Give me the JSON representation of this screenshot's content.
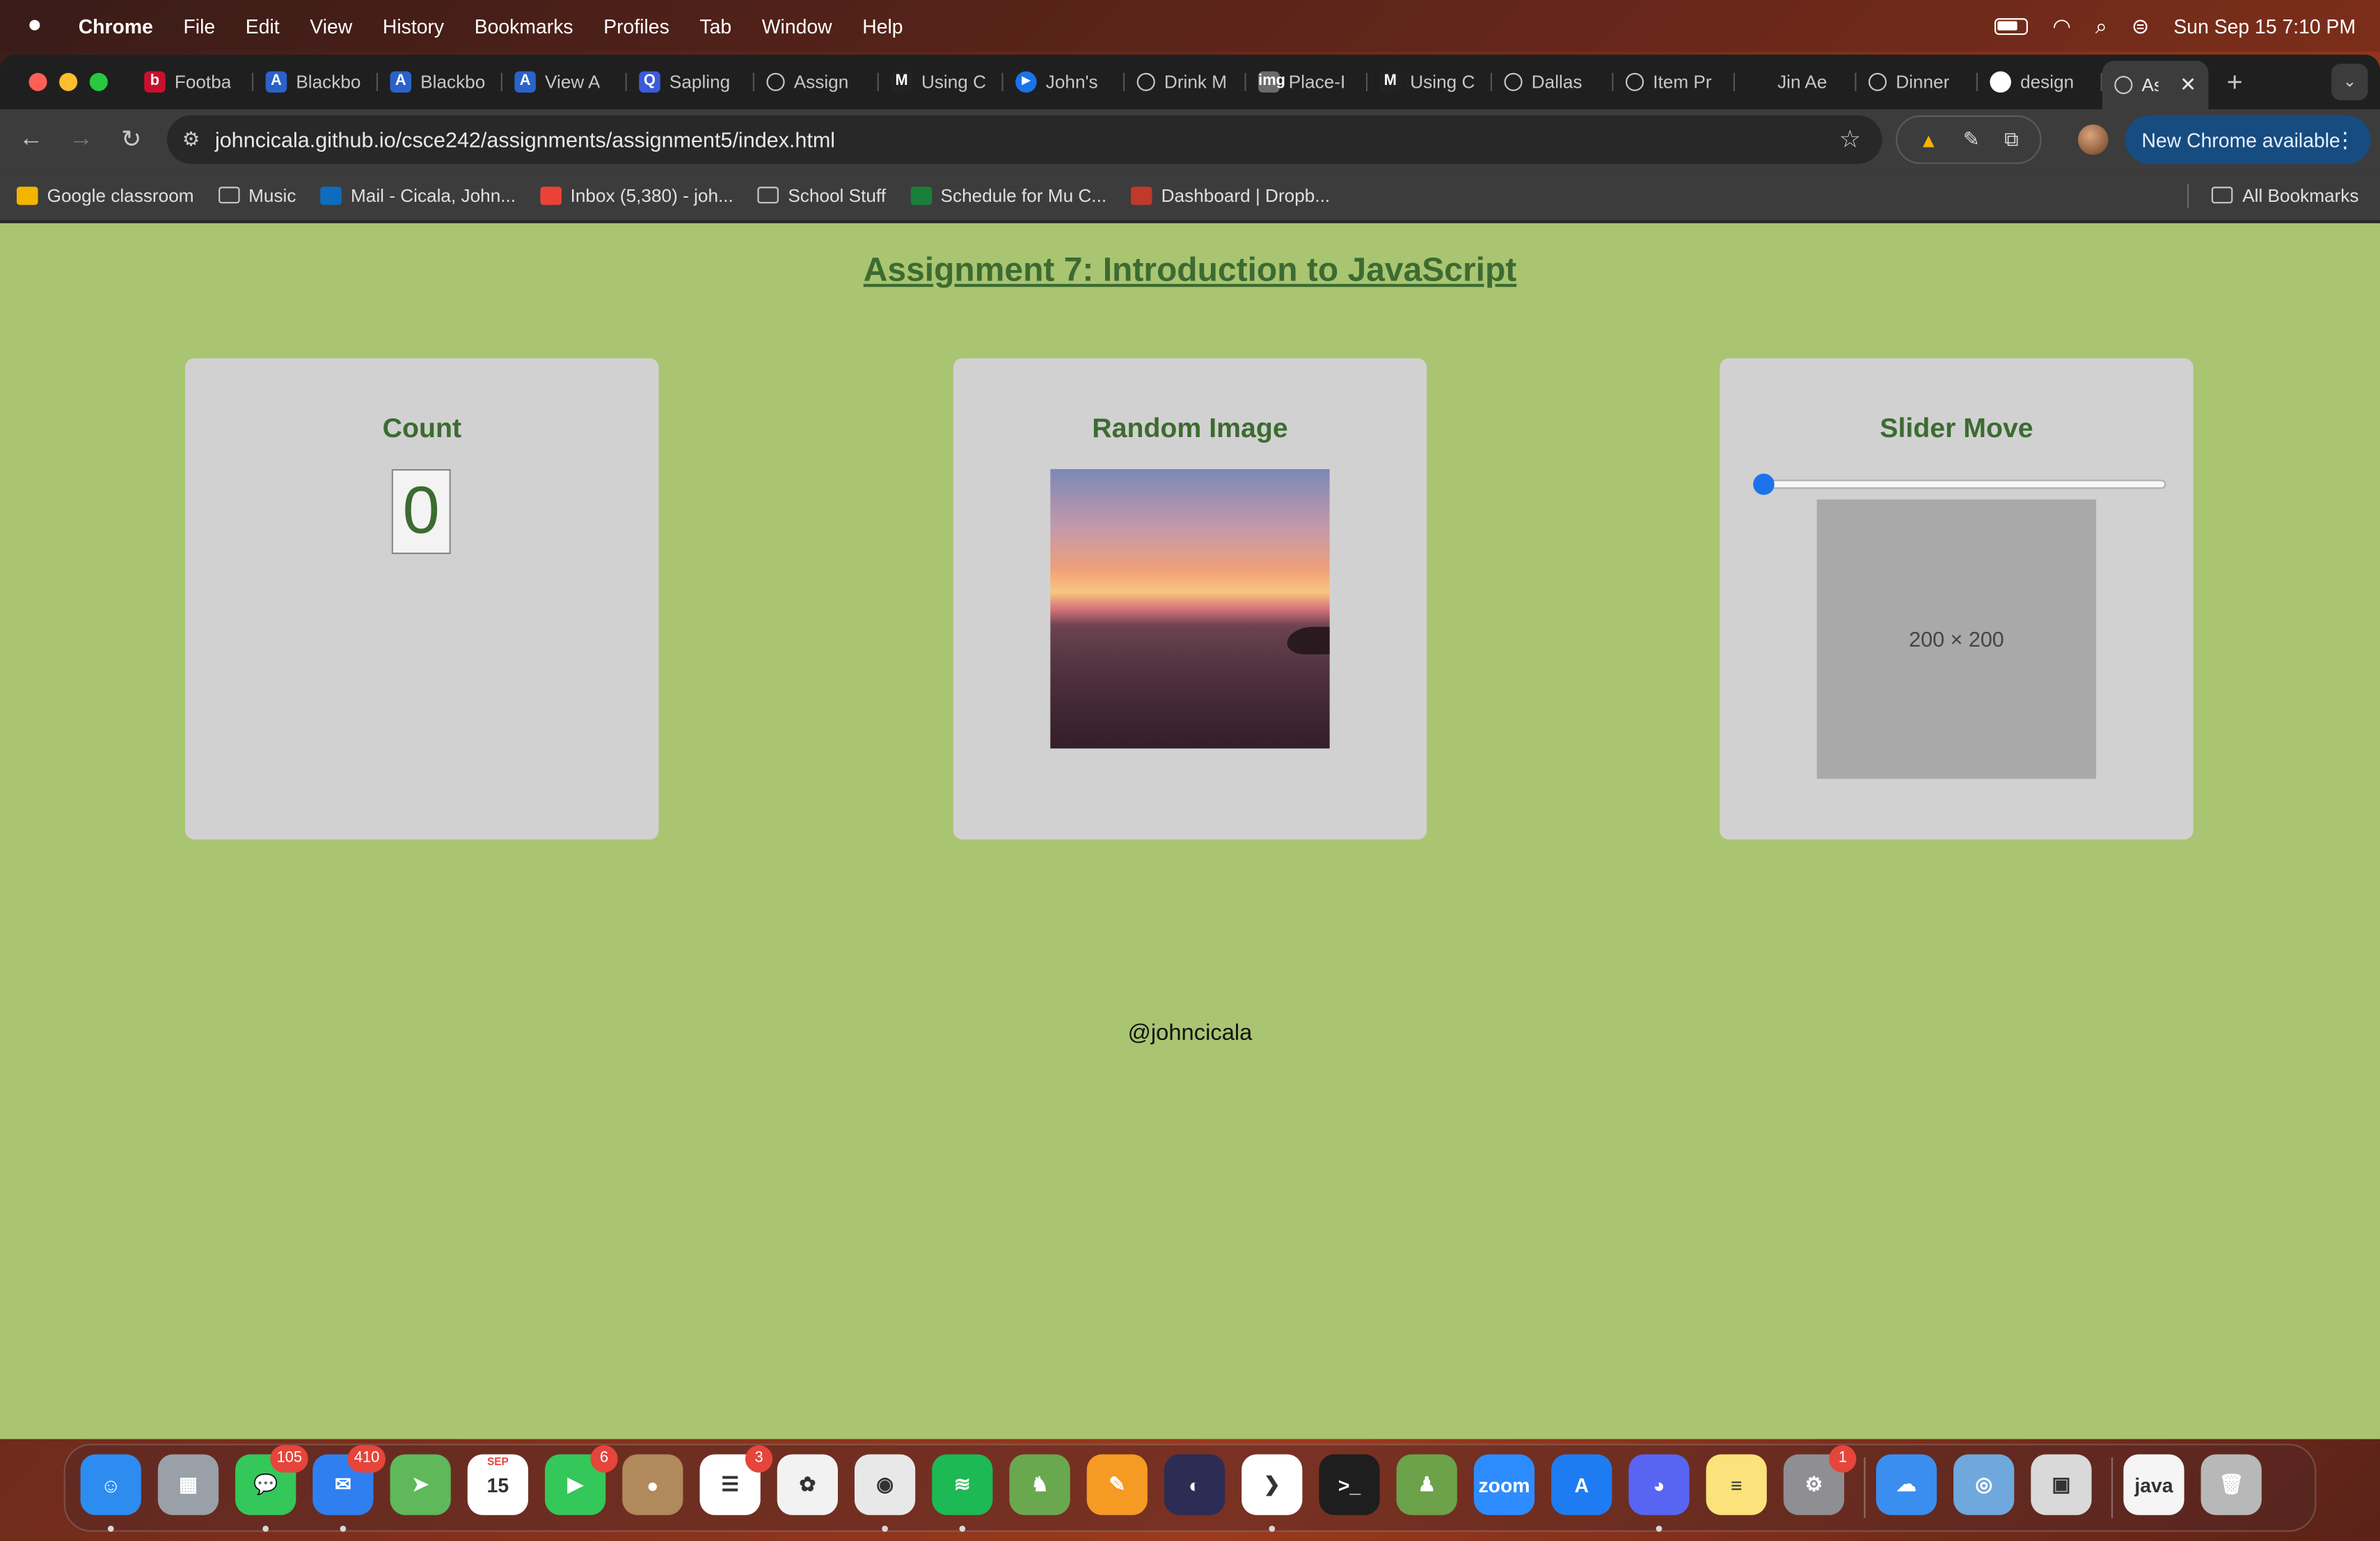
{
  "menubar": {
    "app_name": "Chrome",
    "menus": [
      "File",
      "Edit",
      "View",
      "History",
      "Bookmarks",
      "Profiles",
      "Tab",
      "Window",
      "Help"
    ],
    "datetime": "Sun Sep 15  7:10 PM"
  },
  "tabs": [
    {
      "label": "Footba",
      "icon": "b",
      "color": "#c8102e"
    },
    {
      "label": "Blackbo",
      "icon": "A",
      "color": "#2a62c9"
    },
    {
      "label": "Blackbo",
      "icon": "A",
      "color": "#2a62c9"
    },
    {
      "label": "View A",
      "icon": "A",
      "color": "#2a62c9"
    },
    {
      "label": "Sapling",
      "icon": "Q",
      "color": "#3b5bdb"
    },
    {
      "label": "Assign",
      "icon": "globe",
      "color": "#5f6368"
    },
    {
      "label": "Using C",
      "icon": "M",
      "color": "#222222"
    },
    {
      "label": "John's",
      "icon": "play",
      "color": "#1a73e8"
    },
    {
      "label": "Drink M",
      "icon": "globe",
      "color": "#5f6368"
    },
    {
      "label": "Place-I",
      "icon": "img",
      "color": "#6b6b6b"
    },
    {
      "label": "Using C",
      "icon": "M",
      "color": "#222222"
    },
    {
      "label": "Dallas",
      "icon": "globe",
      "color": "#5f6368"
    },
    {
      "label": "Item Pr",
      "icon": "globe",
      "color": "#5f6368"
    },
    {
      "label": "Jin Ae",
      "icon": "none",
      "color": "#1f1f1f"
    },
    {
      "label": "Dinner",
      "icon": "globe",
      "color": "#5f6368"
    },
    {
      "label": "design",
      "icon": "github",
      "color": "#ffffff"
    },
    {
      "label": "As",
      "icon": "globe",
      "color": "#5f6368",
      "active": true
    }
  ],
  "toolbar": {
    "url": "johncicala.github.io/csce242/assignments/assignment5/index.html",
    "update_label": "New Chrome available"
  },
  "bookmarks": [
    {
      "label": "Google classroom",
      "type": "link",
      "color": "#f4b400"
    },
    {
      "label": "Music",
      "type": "folder"
    },
    {
      "label": "Mail - Cicala, John...",
      "type": "link",
      "color": "#0f6cbd"
    },
    {
      "label": "Inbox (5,380) - joh...",
      "type": "link",
      "color": "#ea4335"
    },
    {
      "label": "School Stuff",
      "type": "folder"
    },
    {
      "label": "Schedule for Mu C...",
      "type": "link",
      "color": "#188038"
    },
    {
      "label": "Dashboard | Dropb...",
      "type": "link",
      "color": "#c0392b"
    }
  ],
  "all_bookmarks_label": "All Bookmarks",
  "page": {
    "title": "Assignment 7: Introduction to JavaScript",
    "count_heading": "Count",
    "count_value": "0",
    "random_heading": "Random Image",
    "slider_heading": "Slider Move",
    "slider_value": 0,
    "placeholder_text": "200 × 200",
    "footer": "@johncicala"
  },
  "dock": [
    {
      "name": "finder",
      "bg": "#2d8cf0",
      "glyph": "☺",
      "running": true
    },
    {
      "name": "launchpad",
      "bg": "#9aa0a8",
      "glyph": "▦",
      "running": false
    },
    {
      "name": "messages",
      "bg": "#34c759",
      "glyph": "💬",
      "badge": "105",
      "running": true
    },
    {
      "name": "mail",
      "bg": "#2f7ff0",
      "glyph": "✉",
      "badge": "410",
      "running": true
    },
    {
      "name": "maps",
      "bg": "#5fb85a",
      "glyph": "➤",
      "running": false
    },
    {
      "name": "calendar",
      "bg": "#ffffff",
      "glyph": "15",
      "month": "SEP",
      "running": false
    },
    {
      "name": "facetime",
      "bg": "#34c759",
      "glyph": "▶",
      "badge": "6",
      "running": false
    },
    {
      "name": "contacts",
      "bg": "#b08a5a",
      "glyph": "●",
      "running": false
    },
    {
      "name": "reminders",
      "bg": "#ffffff",
      "glyph": "☰",
      "badge": "3",
      "running": false
    },
    {
      "name": "photos",
      "bg": "#f2f2f2",
      "glyph": "✿",
      "running": false
    },
    {
      "name": "chrome",
      "bg": "#e8e8e8",
      "glyph": "◉",
      "running": true
    },
    {
      "name": "spotify",
      "bg": "#1db954",
      "glyph": "≋",
      "running": true
    },
    {
      "name": "game",
      "bg": "#6aa84f",
      "glyph": "♞",
      "running": false
    },
    {
      "name": "pages",
      "bg": "#f59a23",
      "glyph": "✎",
      "running": false
    },
    {
      "name": "eclipse",
      "bg": "#2c2c54",
      "glyph": "◐",
      "running": false
    },
    {
      "name": "vscode",
      "bg": "#ffffff",
      "glyph": "❯",
      "running": true
    },
    {
      "name": "terminal",
      "bg": "#1e1e1e",
      "glyph": ">_",
      "running": false
    },
    {
      "name": "chess",
      "bg": "#6ca24a",
      "glyph": "♟",
      "running": false
    },
    {
      "name": "zoom",
      "bg": "#2d8cff",
      "glyph": "zoom",
      "running": false
    },
    {
      "name": "app-store",
      "bg": "#1e7cf2",
      "glyph": "A",
      "running": false
    },
    {
      "name": "discord",
      "bg": "#5865f2",
      "glyph": "◕",
      "running": true
    },
    {
      "name": "notes",
      "bg": "#fbe27a",
      "glyph": "≡",
      "running": false
    },
    {
      "name": "system-settings",
      "bg": "#8e8e93",
      "glyph": "⚙",
      "badge": "1",
      "running": false
    },
    {
      "name": "weather",
      "bg": "#3a8ef0",
      "glyph": "☁",
      "running": false
    },
    {
      "name": "network",
      "bg": "#6fa8dc",
      "glyph": "◎",
      "running": false
    },
    {
      "name": "preview",
      "bg": "#d9d9d9",
      "glyph": "▣",
      "running": false
    },
    {
      "name": "java-file",
      "bg": "#f5f5f5",
      "glyph": "java",
      "running": false
    },
    {
      "name": "trash",
      "bg": "#b8b8b8",
      "glyph": "🗑",
      "running": false
    }
  ]
}
